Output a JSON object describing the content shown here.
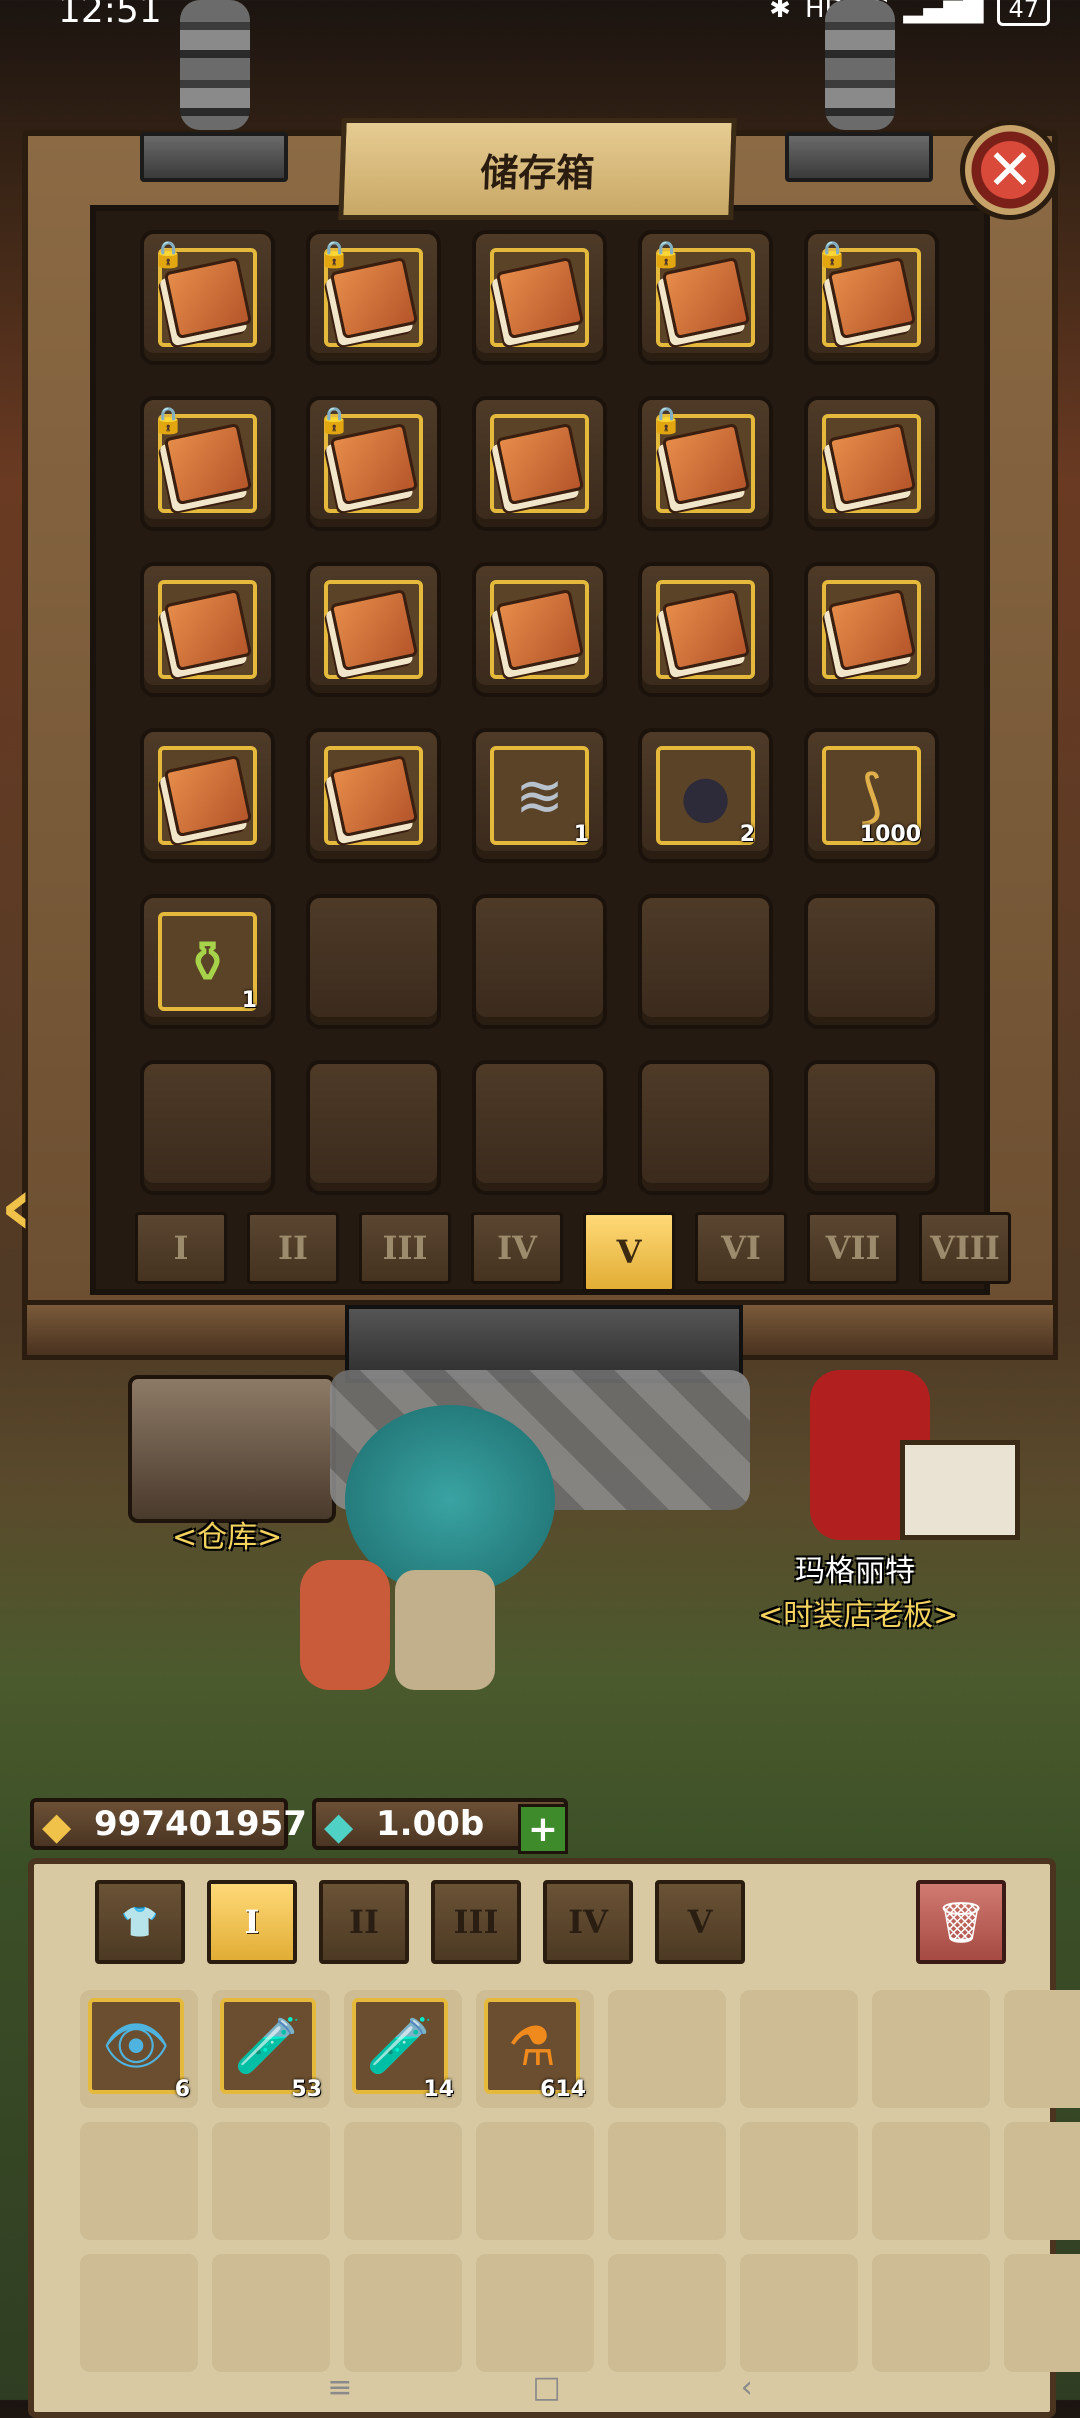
{
  "status_bar": {
    "time": "12:51",
    "indicators": "HD 5G",
    "battery": "47"
  },
  "storage": {
    "title": "储存箱",
    "close_icon": "close-icon",
    "slots": [
      {
        "item": "book",
        "locked": true,
        "qty": ""
      },
      {
        "item": "book",
        "locked": true,
        "qty": ""
      },
      {
        "item": "book",
        "locked": false,
        "qty": ""
      },
      {
        "item": "book",
        "locked": true,
        "qty": ""
      },
      {
        "item": "book",
        "locked": true,
        "qty": ""
      },
      {
        "item": "book",
        "locked": true,
        "qty": ""
      },
      {
        "item": "book",
        "locked": true,
        "qty": ""
      },
      {
        "item": "book",
        "locked": false,
        "qty": ""
      },
      {
        "item": "book",
        "locked": true,
        "qty": ""
      },
      {
        "item": "book",
        "locked": false,
        "qty": ""
      },
      {
        "item": "book",
        "locked": false,
        "qty": ""
      },
      {
        "item": "book",
        "locked": false,
        "qty": ""
      },
      {
        "item": "book",
        "locked": false,
        "qty": ""
      },
      {
        "item": "book",
        "locked": false,
        "qty": ""
      },
      {
        "item": "book",
        "locked": false,
        "qty": ""
      },
      {
        "item": "book",
        "locked": false,
        "qty": ""
      },
      {
        "item": "book",
        "locked": false,
        "qty": ""
      },
      {
        "item": "ore",
        "locked": false,
        "qty": "1"
      },
      {
        "item": "orb",
        "locked": false,
        "qty": "2"
      },
      {
        "item": "feather",
        "locked": false,
        "qty": "1000"
      },
      {
        "item": "potion",
        "locked": false,
        "qty": "1"
      },
      {
        "item": "empty",
        "locked": false,
        "qty": ""
      },
      {
        "item": "empty",
        "locked": false,
        "qty": ""
      },
      {
        "item": "empty",
        "locked": false,
        "qty": ""
      },
      {
        "item": "empty",
        "locked": false,
        "qty": ""
      },
      {
        "item": "empty",
        "locked": false,
        "qty": ""
      },
      {
        "item": "empty",
        "locked": false,
        "qty": ""
      },
      {
        "item": "empty",
        "locked": false,
        "qty": ""
      },
      {
        "item": "empty",
        "locked": false,
        "qty": ""
      },
      {
        "item": "empty",
        "locked": false,
        "qty": ""
      }
    ],
    "pages": [
      "I",
      "II",
      "III",
      "IV",
      "V",
      "VI",
      "VII",
      "VIII"
    ],
    "active_page": 4
  },
  "scene": {
    "warehouse_label": "<仓库>",
    "npc_name": "玛格丽特",
    "npc_title": "<时装店老板>"
  },
  "currency": {
    "gold": "997401957",
    "gems": "1.00b",
    "add_label": "+"
  },
  "inventory": {
    "tabs": [
      "I",
      "II",
      "III",
      "IV",
      "V"
    ],
    "active_tab": 0,
    "items": [
      {
        "icon": "eye-scroll-icon",
        "glyph": "👁",
        "qty": "6"
      },
      {
        "icon": "red-potion-icon",
        "glyph": "🧪",
        "qty": "53"
      },
      {
        "icon": "blue-potion-icon",
        "glyph": "🧪",
        "qty": "14"
      },
      {
        "icon": "orange-flask-icon",
        "glyph": "⚗",
        "qty": "614"
      }
    ]
  },
  "colors": {
    "gold_border": "#e5b93c",
    "active_tab": "#e1ad35",
    "npc_label": "#f2d25c"
  }
}
